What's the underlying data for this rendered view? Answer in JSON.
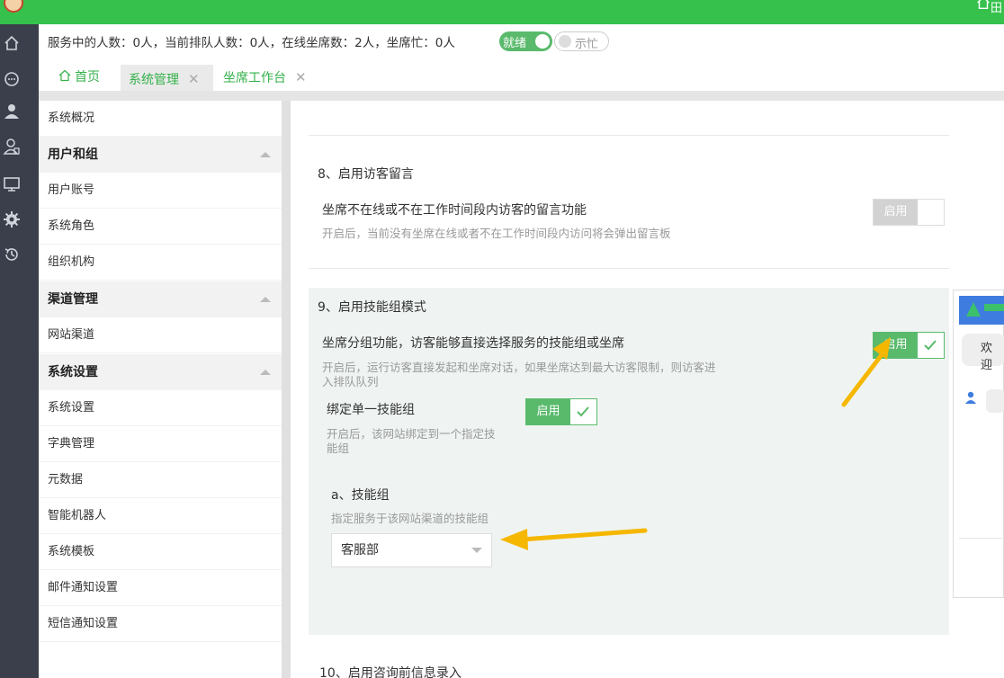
{
  "topbar": {
    "right_text": "田"
  },
  "status": {
    "text": "服务中的人数：0人，当前排队人数：0人，在线坐席数：2人，坐席忙：0人",
    "ready_label": "就绪",
    "busy_label": "示忙"
  },
  "tabs": [
    {
      "label": "首页"
    },
    {
      "label": "系统管理"
    },
    {
      "label": "坐席工作台"
    }
  ],
  "menu": {
    "overview": "系统概况",
    "group_users": "用户和组",
    "user_account": "用户账号",
    "system_role": "系统角色",
    "org": "组织机构",
    "group_channel": "渠道管理",
    "web_channel": "网站渠道",
    "group_settings": "系统设置",
    "sys_settings": "系统设置",
    "dict": "字典管理",
    "metadata": "元数据",
    "robot": "智能机器人",
    "template": "系统模板",
    "mail": "邮件通知设置",
    "sms": "短信通知设置"
  },
  "section8": {
    "title": "8、启用访客留言",
    "label": "坐席不在线或不在工作时间段内访客的留言功能",
    "desc": "开启后，当前没有坐席在线或者不在工作时间段内访问将会弹出留言板",
    "toggle": "启用"
  },
  "section9": {
    "title": "9、启用技能组模式",
    "label": "坐席分组功能，访客能够直接选择服务的技能组或坐席",
    "desc_line1": "开启后，运行访客直接发起和坐席对话，如果坐席达到最大访客限制，则访客进",
    "desc_line2": "入排队队列",
    "toggle": "启用",
    "bind_label": "绑定单一技能组",
    "bind_desc_line1": "开启后，该网站绑定到一个指定技",
    "bind_desc_line2": "能组",
    "bind_toggle": "启用",
    "skill_title": "a、技能组",
    "skill_desc": "指定服务于该网站渠道的技能组",
    "skill_value": "客服部"
  },
  "section10": {
    "title": "10、启用咨询前信息录入"
  },
  "preview": {
    "greeting": "欢迎"
  },
  "colors": {
    "brand_green": "#35c14c",
    "toggle_green": "#5aba6c",
    "arrow": "#f5b700",
    "nav_dark": "#3a3f4b"
  }
}
